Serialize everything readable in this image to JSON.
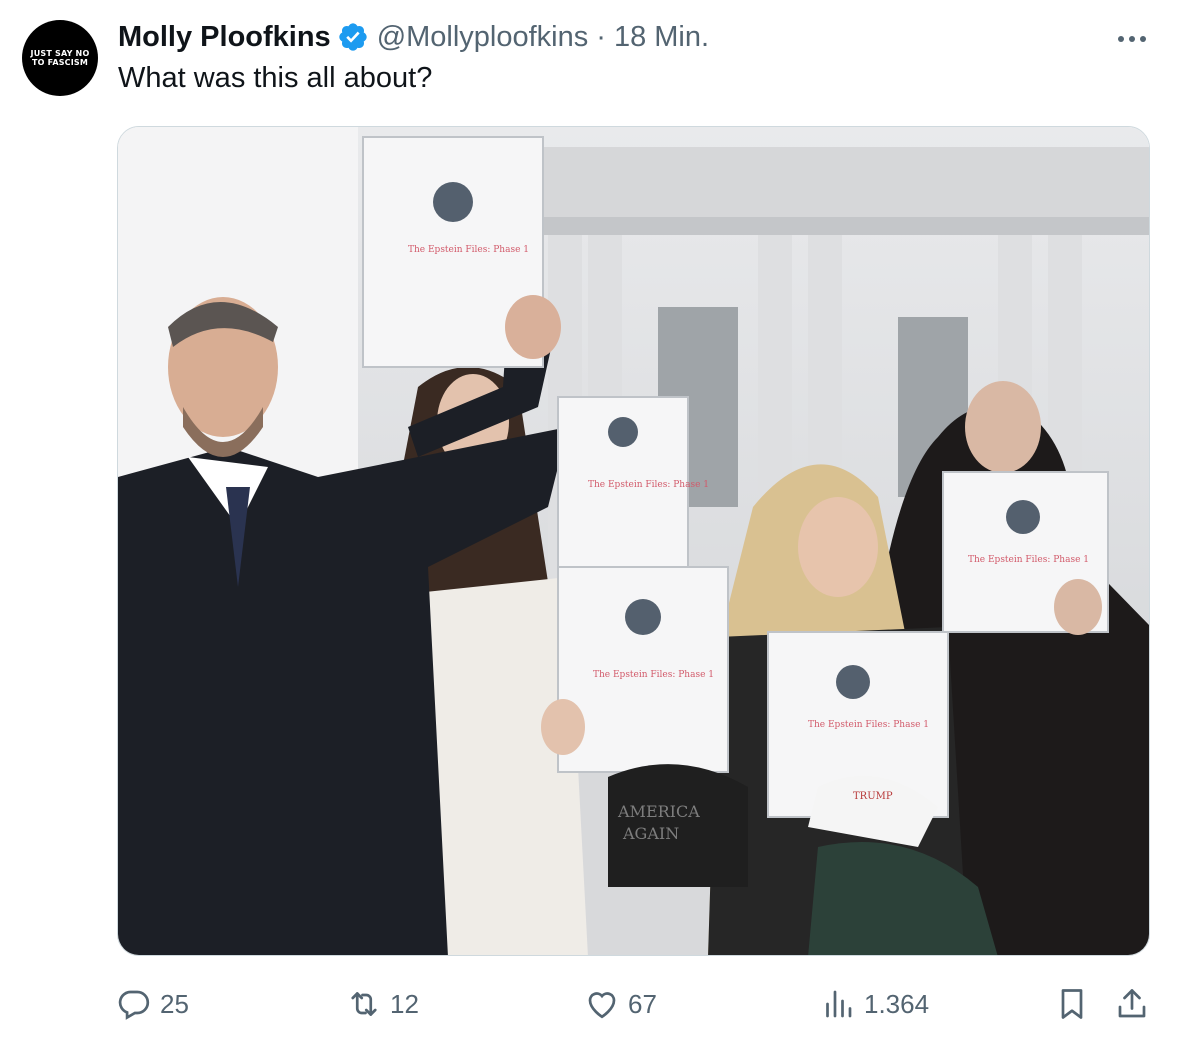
{
  "author": {
    "avatar_text": [
      "JUST SAY NO",
      "TO FASCISM"
    ],
    "display_name": "Molly Ploofkins",
    "handle": "@Mollyploofkins",
    "separator": "·",
    "time": "18 Min.",
    "verified_color": "#1d9bf0"
  },
  "tweet": {
    "text": "What was this all about?"
  },
  "media": {
    "description_icon": "photo",
    "binder_label": "The Epstein Files: Phase 1",
    "cap_text": [
      "AMERICA",
      "AGAIN"
    ],
    "badge_text": "TRUMP"
  },
  "actions": {
    "replies": "25",
    "reposts": "12",
    "likes": "67",
    "views": "1.364"
  },
  "colors": {
    "text_primary": "#0f1419",
    "text_secondary": "#536471",
    "border": "#cfd9de"
  }
}
